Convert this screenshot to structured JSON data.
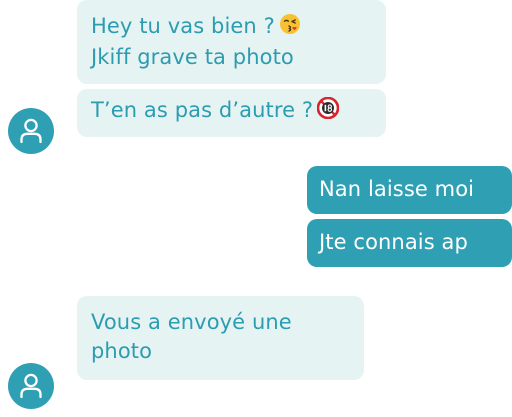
{
  "conversation": {
    "messages": [
      {
        "direction": "incoming",
        "lines": [
          "Hey tu vas bien ?",
          "Jkiff grave ta photo"
        ],
        "emoji": "kissing-face-with-heart"
      },
      {
        "direction": "incoming",
        "lines": [
          "T’en as pas d’autre ?"
        ],
        "emoji": "no-one-under-eighteen"
      },
      {
        "direction": "outgoing",
        "lines": [
          "Nan laisse moi"
        ]
      },
      {
        "direction": "outgoing",
        "lines": [
          "Jte connais ap"
        ]
      },
      {
        "direction": "incoming",
        "lines": [
          "Vous a envoyé une",
          "photo"
        ]
      }
    ]
  },
  "icons": {
    "avatar": "user-icon",
    "kiss": "face-blowing-a-kiss-emoji",
    "adult": "no-one-under-eighteen-emoji"
  },
  "colors": {
    "incoming_bg": "#e6f3f3",
    "incoming_text": "#2c9cb0",
    "outgoing_bg": "#2fa0b3",
    "outgoing_text": "#ffffff",
    "avatar_bg": "#2fa0b3"
  }
}
